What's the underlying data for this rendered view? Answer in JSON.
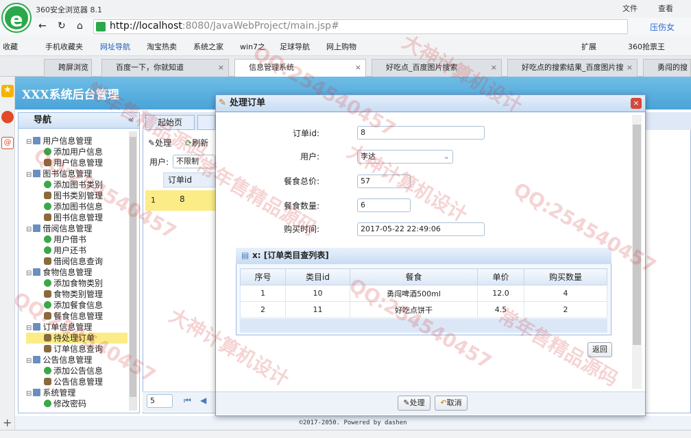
{
  "browser": {
    "title": "360安全浏览器 8.1",
    "menu": [
      "文件",
      "查看"
    ],
    "url_host": "http://localhost",
    "url_path": ":8080/JavaWebProject/main.jsp#",
    "search_placeholder": "压伤女",
    "bookmarks": [
      "收藏",
      "手机收藏夹",
      "网址导航",
      "淘宝热卖",
      "系统之家",
      "win7之",
      "足球导航",
      "网上购物",
      "扩展",
      "360抢票王"
    ],
    "tabs": [
      "跨屏浏览",
      "百度一下，你就知道",
      "信息管理系统",
      "好吃点_百度图片搜索",
      "好吃点的搜索结果_百度图片搜",
      "勇闯的搜"
    ]
  },
  "app": {
    "title": "XXX系统后台管理",
    "nav_title": "导航",
    "nav_items": [
      {
        "label": "用户信息管理",
        "type": "group"
      },
      {
        "label": "添加用户信息",
        "type": "plus"
      },
      {
        "label": "用户信息管理",
        "type": "user"
      },
      {
        "label": "图书信息管理",
        "type": "group"
      },
      {
        "label": "添加图书类别",
        "type": "plus"
      },
      {
        "label": "图书类别管理",
        "type": "user"
      },
      {
        "label": "添加图书信息",
        "type": "plus"
      },
      {
        "label": "图书信息管理",
        "type": "user"
      },
      {
        "label": "借阅信息管理",
        "type": "group"
      },
      {
        "label": "用户借书",
        "type": "plus"
      },
      {
        "label": "用户还书",
        "type": "plus"
      },
      {
        "label": "借阅信息查询",
        "type": "user"
      },
      {
        "label": "食物信息管理",
        "type": "group"
      },
      {
        "label": "添加食物类别",
        "type": "plus"
      },
      {
        "label": "食物类别管理",
        "type": "user"
      },
      {
        "label": "添加餐食信息",
        "type": "plus"
      },
      {
        "label": "餐食信息管理",
        "type": "user"
      },
      {
        "label": "订单信息管理",
        "type": "group"
      },
      {
        "label": "待处理订单",
        "type": "user",
        "selected": true
      },
      {
        "label": "订单信息查询",
        "type": "user"
      },
      {
        "label": "公告信息管理",
        "type": "group"
      },
      {
        "label": "添加公告信息",
        "type": "plus"
      },
      {
        "label": "公告信息管理",
        "type": "user"
      },
      {
        "label": "系统管理",
        "type": "group"
      },
      {
        "label": "修改密码",
        "type": "plus"
      }
    ],
    "main_tabs": [
      "起始页"
    ],
    "toolbar": {
      "process": "处理",
      "refresh": "刷新"
    },
    "filter_label": "用户:",
    "filter_value": "不限制",
    "grid_header": "订单id",
    "grid_row": {
      "num": "1",
      "id": "8"
    },
    "pager_size": "5",
    "footer": "©2017-2050. Powered by dashen"
  },
  "dialog": {
    "title": "处理订单",
    "fields": {
      "order_id_label": "订单id:",
      "order_id": "8",
      "user_label": "用户:",
      "user": "李达",
      "total_label": "餐食总价:",
      "total": "57",
      "qty_label": "餐食数量:",
      "qty": "6",
      "time_label": "购买时间:",
      "time": "2017-05-22 22:49:06"
    },
    "subgrid_title": "x: [订单类目查列表]",
    "columns": [
      "序号",
      "类目id",
      "餐食",
      "单价",
      "购买数量"
    ],
    "rows": [
      [
        "1",
        "10",
        "勇闯啤酒500ml",
        "12.0",
        "4"
      ],
      [
        "2",
        "11",
        "好吃点饼干",
        "4.5",
        "2"
      ]
    ],
    "back_button": "返回",
    "process_button": "处理",
    "cancel_button": "取消"
  },
  "watermarks": [
    "常年售精品源码",
    "QQ:254540457",
    "大神计算机设计"
  ]
}
